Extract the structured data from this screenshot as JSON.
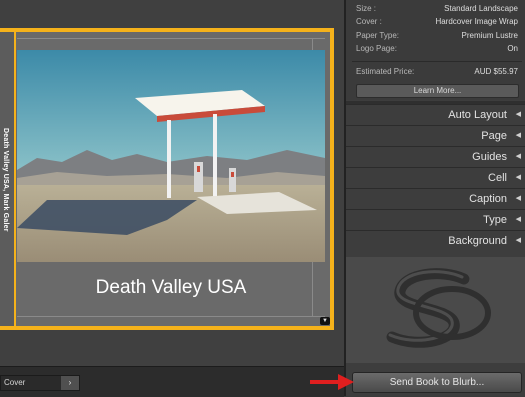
{
  "book": {
    "spine_text": "Death Valley USA, Mark Galer",
    "cover_title": "Death Valley USA"
  },
  "book_settings": {
    "rows": [
      {
        "key": "Size :",
        "value": "Standard Landscape"
      },
      {
        "key": "Cover :",
        "value": "Hardcover Image Wrap"
      },
      {
        "key": "Paper Type:",
        "value": "Premium Lustre"
      },
      {
        "key": "Logo Page:",
        "value": "On"
      }
    ],
    "price_label": "Estimated Price:",
    "price_value": "AUD $55.97",
    "learn_more": "Learn More..."
  },
  "panels": [
    {
      "label": "Auto Layout",
      "icon": "collapse-triangle-icon"
    },
    {
      "label": "Page",
      "icon": "collapse-triangle-icon"
    },
    {
      "label": "Guides",
      "icon": "collapse-triangle-icon"
    },
    {
      "label": "Cell",
      "icon": "collapse-triangle-icon"
    },
    {
      "label": "Caption",
      "icon": "collapse-triangle-icon"
    },
    {
      "label": "Type",
      "icon": "collapse-triangle-icon"
    },
    {
      "label": "Background",
      "icon": "collapse-triangle-icon"
    }
  ],
  "send_button": "Send Book to Blurb...",
  "page_selector": {
    "value": "Cover",
    "arrow": "›"
  },
  "colors": {
    "selection": "#f5b21b",
    "arrow": "#e01f1f"
  }
}
